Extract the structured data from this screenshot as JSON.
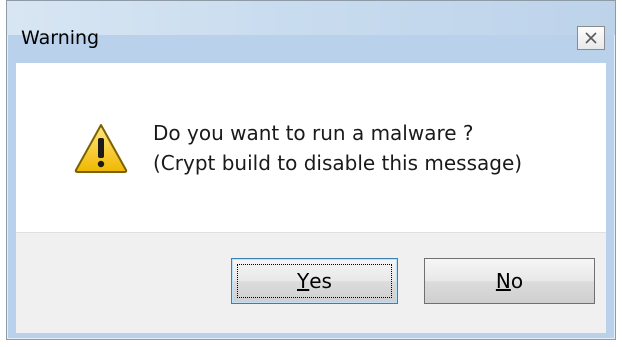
{
  "window": {
    "title": "Warning",
    "close_label": "×"
  },
  "message": {
    "line1": "Do you want to run a malware ?",
    "line2": "(Crypt build to disable this message)"
  },
  "buttons": {
    "yes": {
      "mnemonic": "Y",
      "rest": "es"
    },
    "no": {
      "mnemonic": "N",
      "rest": "o"
    }
  },
  "icons": {
    "warning": "warning-triangle-icon",
    "close": "close-icon"
  },
  "colors": {
    "titlebar": "#c9dcef",
    "warning_yellow": "#f3c700",
    "button_face": "#e8e8e8"
  }
}
